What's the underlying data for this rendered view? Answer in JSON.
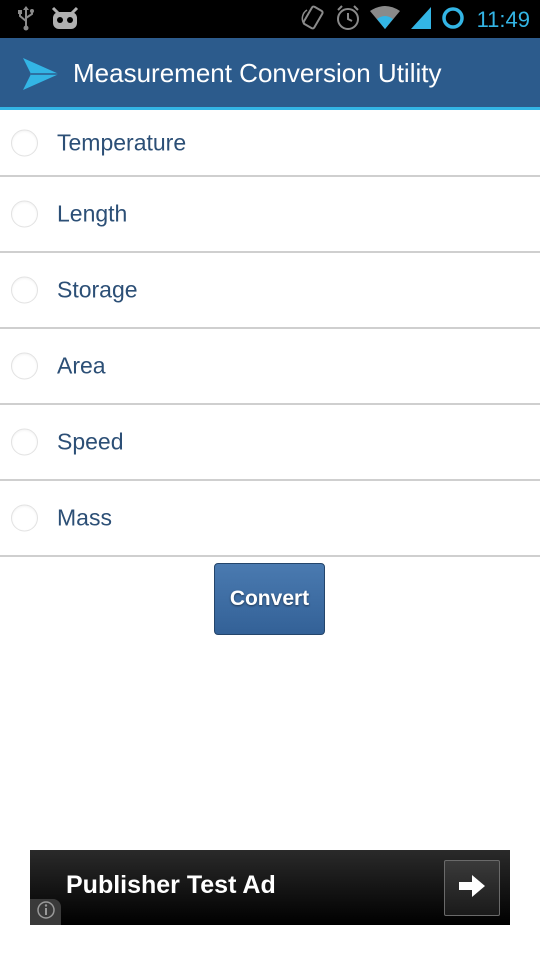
{
  "status_bar": {
    "time": "11:49",
    "icons": [
      "usb-icon",
      "android-debug-icon",
      "rotation-lock-icon",
      "alarm-icon",
      "wifi-icon",
      "signal-icon",
      "battery-ring-icon"
    ]
  },
  "action_bar": {
    "app_icon": "paper-plane-icon",
    "title": "Measurement Conversion Utility"
  },
  "radio_options": [
    {
      "label": "Temperature",
      "selected": false
    },
    {
      "label": "Length",
      "selected": false
    },
    {
      "label": "Storage",
      "selected": false
    },
    {
      "label": "Area",
      "selected": false
    },
    {
      "label": "Speed",
      "selected": false
    },
    {
      "label": "Mass",
      "selected": false
    }
  ],
  "convert_button": {
    "label": "Convert"
  },
  "ad": {
    "text": "Publisher Test Ad",
    "arrow_icon": "arrow-right-icon",
    "info_icon": "info-icon"
  },
  "colors": {
    "action_bar": "#2c5b8c",
    "accent": "#33b5e5",
    "label_text": "#2c4f76",
    "button": "#336197"
  }
}
